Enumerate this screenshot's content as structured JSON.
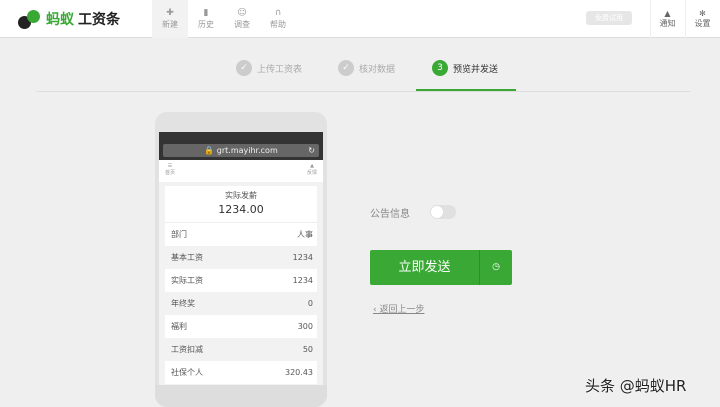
{
  "brand": {
    "part1": "蚂蚁",
    "part2": "工资条"
  },
  "nav": [
    {
      "icon": "new-icon",
      "glyph": "✚",
      "label": "新建"
    },
    {
      "icon": "history-icon",
      "glyph": "▮",
      "label": "历史"
    },
    {
      "icon": "survey-icon",
      "glyph": "☺",
      "label": "调查"
    },
    {
      "icon": "help-icon",
      "glyph": "∩",
      "label": "帮助"
    }
  ],
  "trial_label": "免费试用",
  "notify": {
    "glyph": "▲",
    "label": "通知"
  },
  "settings": {
    "glyph": "✻",
    "label": "设置"
  },
  "steps": [
    {
      "num": "✓",
      "label": "上传工资表"
    },
    {
      "num": "✓",
      "label": "核对数据"
    },
    {
      "num": "3",
      "label": "预览并发送"
    }
  ],
  "phone": {
    "url": "grt.mayihr.com",
    "left_tab": "首页",
    "right_tab": "反馈",
    "summary_label": "实际发薪",
    "summary_value": "1234.00",
    "rows": [
      {
        "k": "部门",
        "v": "人事"
      },
      {
        "k": "基本工资",
        "v": "1234"
      },
      {
        "k": "实际工资",
        "v": "1234"
      },
      {
        "k": "年终奖",
        "v": "0"
      },
      {
        "k": "福利",
        "v": "300"
      },
      {
        "k": "工资扣减",
        "v": "50"
      },
      {
        "k": "社保个人",
        "v": "320.43"
      }
    ]
  },
  "notice_label": "公告信息",
  "notice_enabled": false,
  "send_label": "立即发送",
  "back_label": "返回上一步",
  "watermark": "头条 @蚂蚁HR",
  "colors": {
    "accent": "#3aa835"
  }
}
